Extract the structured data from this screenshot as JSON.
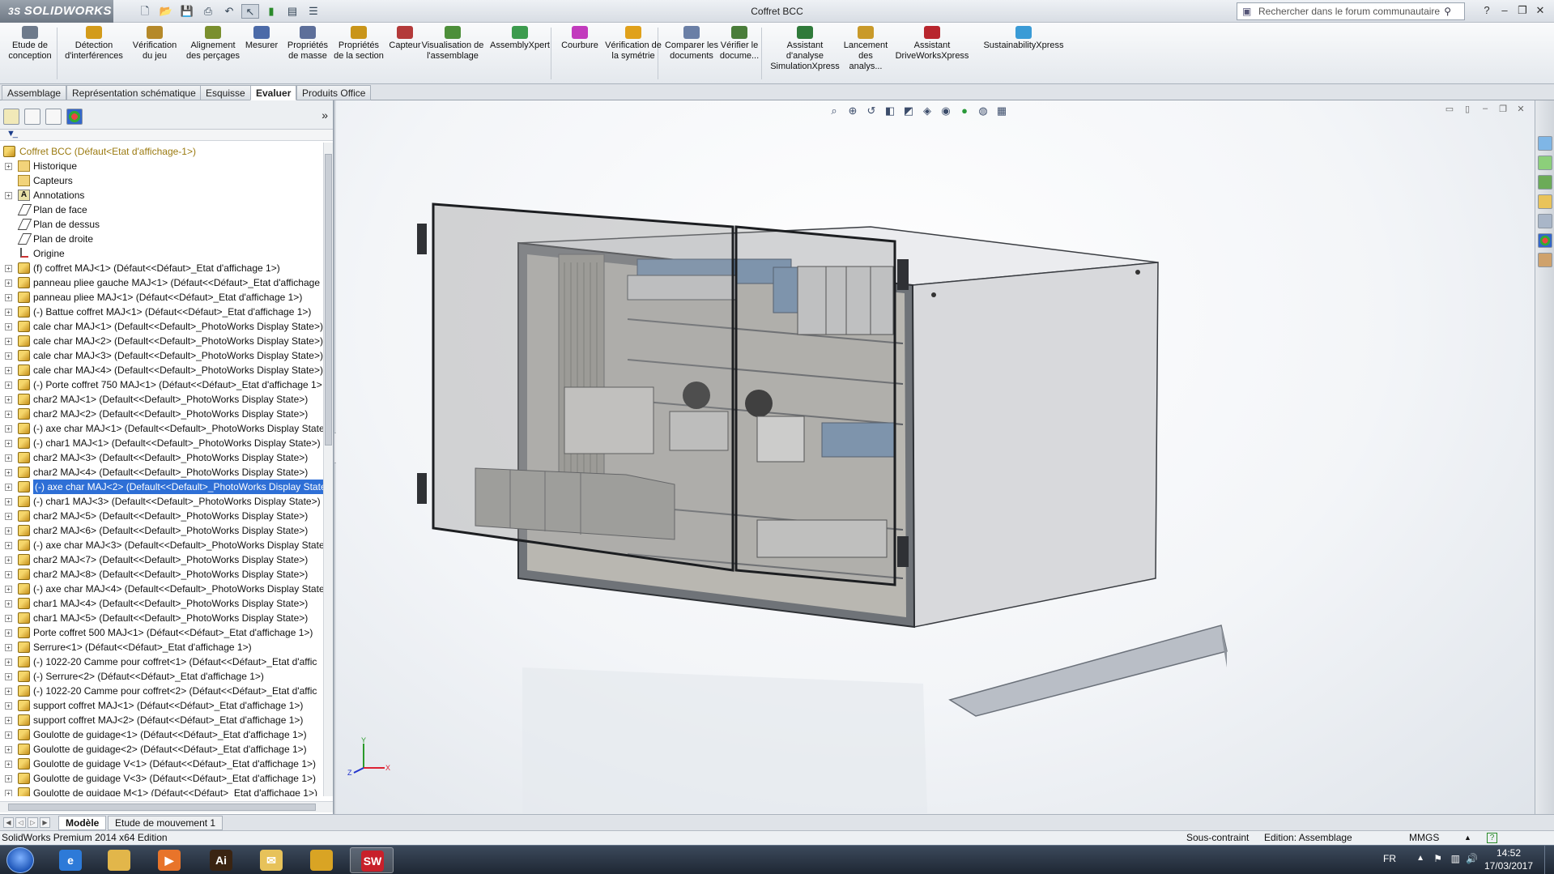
{
  "app": {
    "logo_text": "SOLIDWORKS",
    "logo_mark": "3S",
    "document_title": "Coffret BCC",
    "search_placeholder": "Rechercher dans le forum communautaire"
  },
  "ribbon": {
    "buttons": [
      {
        "label": "Etude de conception",
        "icon": "design-study-icon",
        "color": "#6d7a8b"
      },
      {
        "label": "Détection d'interférences",
        "icon": "interference-icon",
        "color": "#d39b1a"
      },
      {
        "label": "Vérification du jeu",
        "icon": "clearance-icon",
        "color": "#b5892a"
      },
      {
        "label": "Alignement des perçages",
        "icon": "hole-alignment-icon",
        "color": "#7a8f2e"
      },
      {
        "label": "Mesurer",
        "icon": "measure-icon",
        "color": "#4b6aa8"
      },
      {
        "label": "Propriétés de masse",
        "icon": "mass-properties-icon",
        "color": "#5d6f9a"
      },
      {
        "label": "Propriétés de la section",
        "icon": "section-properties-icon",
        "color": "#c9951a"
      },
      {
        "label": "Capteur",
        "icon": "sensor-icon",
        "color": "#b33a3a"
      },
      {
        "label": "Visualisation de l'assemblage",
        "icon": "assembly-visualization-icon",
        "color": "#4d8f3a"
      },
      {
        "label": "AssemblyXpert",
        "icon": "assemblyxpert-icon",
        "color": "#3c9b4e"
      },
      {
        "label": "Courbure",
        "icon": "curvature-icon",
        "color": "#c23bbd"
      },
      {
        "label": "Vérification de la symétrie",
        "icon": "symmetry-icon",
        "color": "#e0a11b"
      },
      {
        "label": "Comparer les documents",
        "icon": "compare-icon",
        "color": "#6a7fa6"
      },
      {
        "label": "Vérifier le docume...",
        "icon": "check-document-icon",
        "color": "#4a7d3a"
      },
      {
        "label": "Assistant d'analyse SimulationXpress",
        "icon": "simulationxpress-icon",
        "color": "#2f7a3a"
      },
      {
        "label": "Lancement des analys...",
        "icon": "floxpress-icon",
        "color": "#c99a2a"
      },
      {
        "label": "Assistant DriveWorksXpress",
        "icon": "driveworks-icon",
        "color": "#b8262e"
      },
      {
        "label": "SustainabilityXpress",
        "icon": "sustainability-icon",
        "color": "#3a9bd6"
      }
    ]
  },
  "command_tabs": [
    {
      "label": "Assemblage",
      "active": false
    },
    {
      "label": "Représentation schématique",
      "active": false
    },
    {
      "label": "Esquisse",
      "active": false
    },
    {
      "label": "Evaluer",
      "active": true
    },
    {
      "label": "Produits Office",
      "active": false
    }
  ],
  "tree": {
    "root": "Coffret BCC  (Défaut<Etat d'affichage-1>)",
    "items": [
      {
        "label": "Historique",
        "icon": "folder"
      },
      {
        "label": "Capteurs",
        "icon": "folder"
      },
      {
        "label": "Annotations",
        "icon": "note"
      },
      {
        "label": "Plan de face",
        "icon": "plane"
      },
      {
        "label": "Plan de dessus",
        "icon": "plane"
      },
      {
        "label": "Plan de droite",
        "icon": "plane"
      },
      {
        "label": "Origine",
        "icon": "origin"
      },
      {
        "label": "(f) coffret MAJ<1> (Défaut<<Défaut>_Etat d'affichage 1>)",
        "icon": "part"
      },
      {
        "label": "panneau pliee gauche MAJ<1> (Défaut<<Défaut>_Etat d'affichage",
        "icon": "part"
      },
      {
        "label": "panneau pliee MAJ<1> (Défaut<<Défaut>_Etat d'affichage 1>)",
        "icon": "part"
      },
      {
        "label": "(-) Battue coffret MAJ<1> (Défaut<<Défaut>_Etat d'affichage 1>)",
        "icon": "part"
      },
      {
        "label": "cale char MAJ<1> (Default<<Default>_PhotoWorks Display State>)",
        "icon": "part"
      },
      {
        "label": "cale char MAJ<2> (Default<<Default>_PhotoWorks Display State>)",
        "icon": "part"
      },
      {
        "label": "cale char MAJ<3> (Default<<Default>_PhotoWorks Display State>)",
        "icon": "part"
      },
      {
        "label": "cale char MAJ<4> (Default<<Default>_PhotoWorks Display State>)",
        "icon": "part"
      },
      {
        "label": "(-) Porte coffret 750 MAJ<1> (Défaut<<Défaut>_Etat d'affichage 1>",
        "icon": "part"
      },
      {
        "label": "char2 MAJ<1> (Default<<Default>_PhotoWorks Display State>)",
        "icon": "part"
      },
      {
        "label": "char2 MAJ<2> (Default<<Default>_PhotoWorks Display State>)",
        "icon": "part"
      },
      {
        "label": "(-) axe char MAJ<1> (Default<<Default>_PhotoWorks Display State",
        "icon": "part"
      },
      {
        "label": "(-) char1 MAJ<1> (Default<<Default>_PhotoWorks Display State>)",
        "icon": "part"
      },
      {
        "label": "char2 MAJ<3> (Default<<Default>_PhotoWorks Display State>)",
        "icon": "part"
      },
      {
        "label": "char2 MAJ<4> (Default<<Default>_PhotoWorks Display State>)",
        "icon": "part"
      },
      {
        "label": "(-) axe char MAJ<2> (Default<<Default>_PhotoWorks Display State",
        "icon": "part",
        "selected": true
      },
      {
        "label": "(-) char1 MAJ<3> (Default<<Default>_PhotoWorks Display State>)",
        "icon": "part"
      },
      {
        "label": "char2 MAJ<5> (Default<<Default>_PhotoWorks Display State>)",
        "icon": "part"
      },
      {
        "label": "char2 MAJ<6> (Default<<Default>_PhotoWorks Display State>)",
        "icon": "part"
      },
      {
        "label": "(-) axe char MAJ<3> (Default<<Default>_PhotoWorks Display State",
        "icon": "part"
      },
      {
        "label": "char2 MAJ<7> (Default<<Default>_PhotoWorks Display State>)",
        "icon": "part"
      },
      {
        "label": "char2 MAJ<8> (Default<<Default>_PhotoWorks Display State>)",
        "icon": "part"
      },
      {
        "label": "(-) axe char MAJ<4> (Default<<Default>_PhotoWorks Display State",
        "icon": "part"
      },
      {
        "label": "char1 MAJ<4> (Default<<Default>_PhotoWorks Display State>)",
        "icon": "part"
      },
      {
        "label": "char1 MAJ<5> (Default<<Default>_PhotoWorks Display State>)",
        "icon": "part"
      },
      {
        "label": "Porte coffret 500 MAJ<1> (Défaut<<Défaut>_Etat d'affichage 1>)",
        "icon": "part"
      },
      {
        "label": "Serrure<1> (Défaut<<Défaut>_Etat d'affichage 1>)",
        "icon": "part"
      },
      {
        "label": "(-) 1022-20 Camme  pour coffret<1> (Défaut<<Défaut>_Etat d'affic",
        "icon": "part"
      },
      {
        "label": "(-) Serrure<2> (Défaut<<Défaut>_Etat d'affichage 1>)",
        "icon": "part"
      },
      {
        "label": "(-) 1022-20 Camme  pour coffret<2> (Défaut<<Défaut>_Etat d'affic",
        "icon": "part"
      },
      {
        "label": "support coffret MAJ<1> (Défaut<<Défaut>_Etat d'affichage 1>)",
        "icon": "part"
      },
      {
        "label": "support coffret MAJ<2> (Défaut<<Défaut>_Etat d'affichage 1>)",
        "icon": "part"
      },
      {
        "label": "Goulotte de guidage<1> (Défaut<<Défaut>_Etat d'affichage 1>)",
        "icon": "part"
      },
      {
        "label": "Goulotte de guidage<2> (Défaut<<Défaut>_Etat d'affichage 1>)",
        "icon": "part"
      },
      {
        "label": "Goulotte de guidage V<1> (Défaut<<Défaut>_Etat d'affichage 1>)",
        "icon": "part"
      },
      {
        "label": "Goulotte de guidage V<3> (Défaut<<Défaut>_Etat d'affichage 1>)",
        "icon": "part"
      },
      {
        "label": "Goulotte de guidage M<1> (Défaut<<Défaut>_Etat d'affichage 1>)",
        "icon": "part"
      }
    ]
  },
  "bottom_tabs": [
    {
      "label": "Modèle",
      "active": true
    },
    {
      "label": "Etude de mouvement 1",
      "active": false
    }
  ],
  "status": {
    "product": "SolidWorks Premium 2014 x64 Edition",
    "constraint": "Sous-contraint",
    "mode": "Edition: Assemblage",
    "units": "MMGS",
    "help": "?"
  },
  "taskbar": {
    "apps": [
      {
        "name": "internet-explorer-icon",
        "glyph": "e",
        "color": "#2d7ad8"
      },
      {
        "name": "file-explorer-icon",
        "glyph": "",
        "color": "#e2b64a"
      },
      {
        "name": "media-player-icon",
        "glyph": "▶",
        "color": "#e8742a"
      },
      {
        "name": "illustrator-icon",
        "glyph": "Ai",
        "color": "#3a2412"
      },
      {
        "name": "mail-icon",
        "glyph": "✉",
        "color": "#e7c25a"
      },
      {
        "name": "chrome-icon",
        "glyph": "",
        "color": "#d9a424"
      },
      {
        "name": "solidworks-icon",
        "glyph": "SW",
        "color": "#c8202a"
      }
    ],
    "lang": "FR",
    "time": "14:52",
    "date": "17/03/2017"
  },
  "triad": {
    "x": "X",
    "y": "Y",
    "z": "Z"
  }
}
